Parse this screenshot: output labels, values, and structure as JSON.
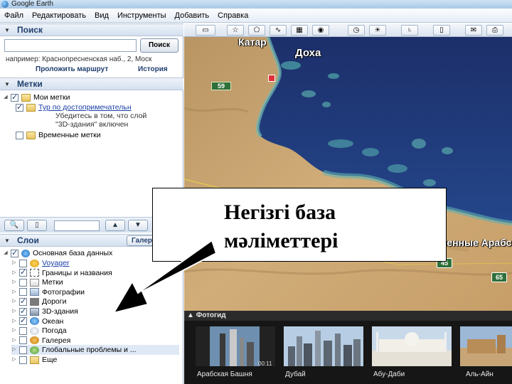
{
  "window": {
    "title": "Google Earth"
  },
  "menu": [
    "Файл",
    "Редактировать",
    "Вид",
    "Инструменты",
    "Добавить",
    "Справка"
  ],
  "search": {
    "header": "Поиск",
    "button": "Поиск",
    "hint": "например: Краснопресненская наб., 2, Моск",
    "route_link": "Проложить маршрут",
    "history_link": "История"
  },
  "places": {
    "header": "Метки",
    "items": [
      {
        "label": "Мои метки"
      },
      {
        "label": "Тур по достопримечательн"
      },
      {
        "label": "Убедитесь в том, что слой"
      },
      {
        "label": "\"3D-здания\" включен"
      },
      {
        "label": "Временные метки"
      }
    ]
  },
  "layers": {
    "header": "Слои",
    "gallery_button": "Галерея »",
    "items": [
      {
        "label": "Основная база данных",
        "checked": true
      },
      {
        "label": "Voyager",
        "checked": false
      },
      {
        "label": "Границы и названия",
        "checked": true
      },
      {
        "label": "Метки",
        "checked": false
      },
      {
        "label": "Фотографии",
        "checked": false
      },
      {
        "label": "Дороги",
        "checked": true
      },
      {
        "label": "3D-здания",
        "checked": true
      },
      {
        "label": "Океан",
        "checked": true
      },
      {
        "label": "Погода",
        "checked": false
      },
      {
        "label": "Галерея",
        "checked": false
      },
      {
        "label": "Глобальные проблемы и ...",
        "checked": false
      },
      {
        "label": "Еще",
        "checked": false
      }
    ]
  },
  "map": {
    "labels": {
      "country": "Катар",
      "city": "Доха",
      "region": "Объединенные Арабские"
    },
    "shields": [
      "59",
      "45",
      "65"
    ]
  },
  "photos": {
    "header": "Фотогид",
    "items": [
      {
        "caption": "Арабская Башня",
        "duration": "00:11"
      },
      {
        "caption": "Дубай"
      },
      {
        "caption": "Абу-Даби"
      },
      {
        "caption": "Аль-Айн"
      }
    ]
  },
  "annotation": {
    "text": "Негізгі база\nмәліметтері"
  },
  "colors": {
    "sea": "#1e3a78",
    "desert": "#c9a571",
    "panel_header": "#d4e0ef",
    "link": "#1a3fa6"
  }
}
